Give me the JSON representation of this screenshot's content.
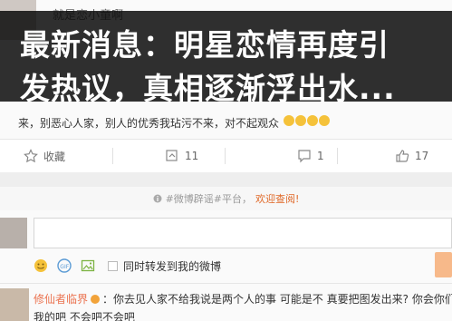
{
  "headline": {
    "line1": "最新消息：明星恋情再度引",
    "line2": "发热议，真相逐渐浮出水..."
  },
  "post": {
    "author": "就是恋小童啊",
    "text_line": "来，别恶心人家，别人的优秀我玷污不来，对不起观众"
  },
  "actions": {
    "favorite_label": "收藏",
    "repost_count": "11",
    "comment_count": "1",
    "like_count": "17"
  },
  "notice": {
    "text": "#微博辟谣#平台，",
    "link": "欢迎查阅!"
  },
  "composer": {
    "repost_label": "同时转发到我的微博"
  },
  "comment": {
    "user": "修仙者临界",
    "line1": "：你去见人家不给我说是两个人的事  可能是不  真要把图发出来?  你会你们",
    "line2": "我的吧  不会吧不会吧"
  },
  "colors": {
    "accent": "#eb7350",
    "overlay": "#111111"
  }
}
